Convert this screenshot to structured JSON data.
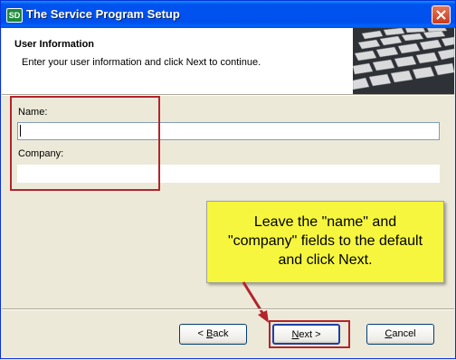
{
  "window": {
    "title": "The Service Program Setup",
    "app_icon_text": "SD"
  },
  "header": {
    "title": "User Information",
    "subtitle": "Enter your user information and click Next to continue."
  },
  "form": {
    "name_label": "Name:",
    "name_value": "",
    "company_label": "Company:",
    "company_value": ""
  },
  "callout": {
    "text": "Leave the \"name\" and\n\"company\" fields to the default\nand click Next."
  },
  "buttons": {
    "back_pre": "< ",
    "back_ul": "B",
    "back_post": "ack",
    "next_ul": "N",
    "next_post": "ext >",
    "cancel_ul": "C",
    "cancel_post": "ancel"
  },
  "colors": {
    "highlight": "#b3242b",
    "callout_bg": "#f6f63e",
    "titlebar": "#0053ee"
  }
}
